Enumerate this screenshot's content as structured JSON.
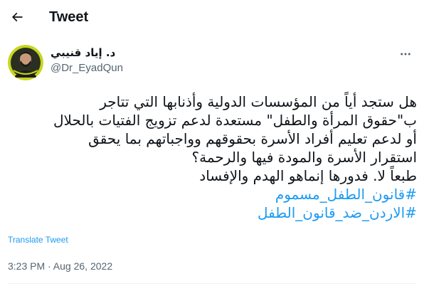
{
  "header": {
    "back_icon": "arrow-left-icon",
    "title": "Tweet"
  },
  "author": {
    "name": "د. إياد قنيبي",
    "handle": "@Dr_EyadQun",
    "avatar_icon": "profile-photo",
    "more_icon": "more-dots-icon"
  },
  "tweet": {
    "lines": [
      "هل ستجد أياً من المؤسسات الدولية وأذنابها التي تتاجر",
      "ب\"حقوق المرأة والطفل\" مستعدة لدعم تزويج الفتيات بالحلال",
      "أو لدعم تعليم أفراد الأسرة بحقوقهم وواجباتهم بما يحقق",
      "استقرار الأسرة والمودة فيها والرحمة؟",
      "طبعاً لا. فدورها إنماهو الهدم والإفساد"
    ],
    "hashtags": [
      "#قانون_الطفل_مسموم",
      "#الاردن_ضد_قانون_الطفل"
    ],
    "translate_label": "Translate Tweet",
    "timestamp": "3:23 PM · Aug 26, 2022"
  },
  "colors": {
    "accent": "#1d9bf0",
    "text": "#0f1419",
    "secondary": "#536471",
    "avatar_bg": "#c5d61e"
  }
}
